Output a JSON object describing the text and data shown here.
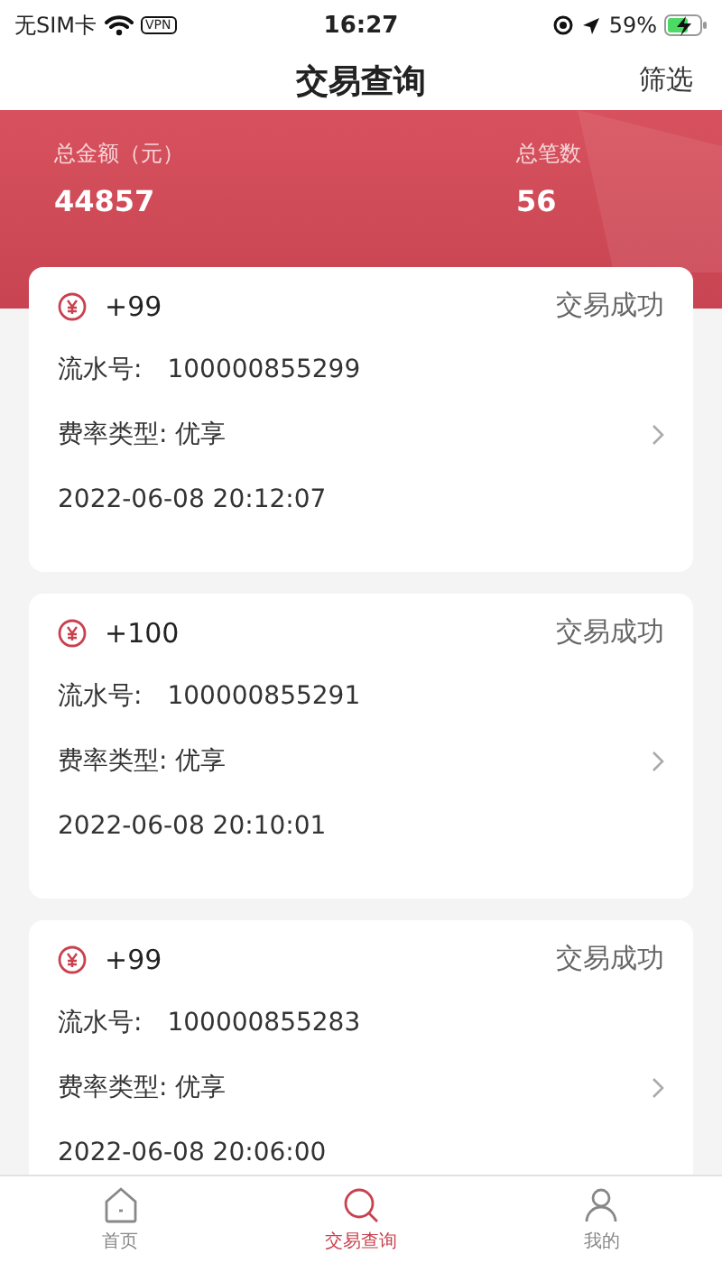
{
  "status_bar": {
    "carrier": "无SIM卡",
    "vpn": "VPN",
    "time": "16:27",
    "battery": "59%"
  },
  "nav": {
    "title": "交易查询",
    "action": "筛选"
  },
  "summary": [
    {
      "label": "总金额（元）",
      "value": "44857"
    },
    {
      "label": "总笔数",
      "value": "56"
    }
  ],
  "transactions": [
    {
      "amount": "+99",
      "status": "交易成功",
      "serial_label": "流水号:",
      "serial": "100000855299",
      "rate": "费率类型: 优享",
      "time": "2022-06-08 20:12:07"
    },
    {
      "amount": "+100",
      "status": "交易成功",
      "serial_label": "流水号:",
      "serial": "100000855291",
      "rate": "费率类型: 优享",
      "time": "2022-06-08 20:10:01"
    },
    {
      "amount": "+99",
      "status": "交易成功",
      "serial_label": "流水号:",
      "serial": "100000855283",
      "rate": "费率类型: 优享",
      "time": "2022-06-08 20:06:00"
    }
  ],
  "tab_bar": [
    {
      "label": "首页",
      "kind": "home",
      "selected": false
    },
    {
      "label": "交易查询",
      "kind": "search",
      "selected": true
    },
    {
      "label": "我的",
      "kind": "user",
      "selected": false
    }
  ]
}
